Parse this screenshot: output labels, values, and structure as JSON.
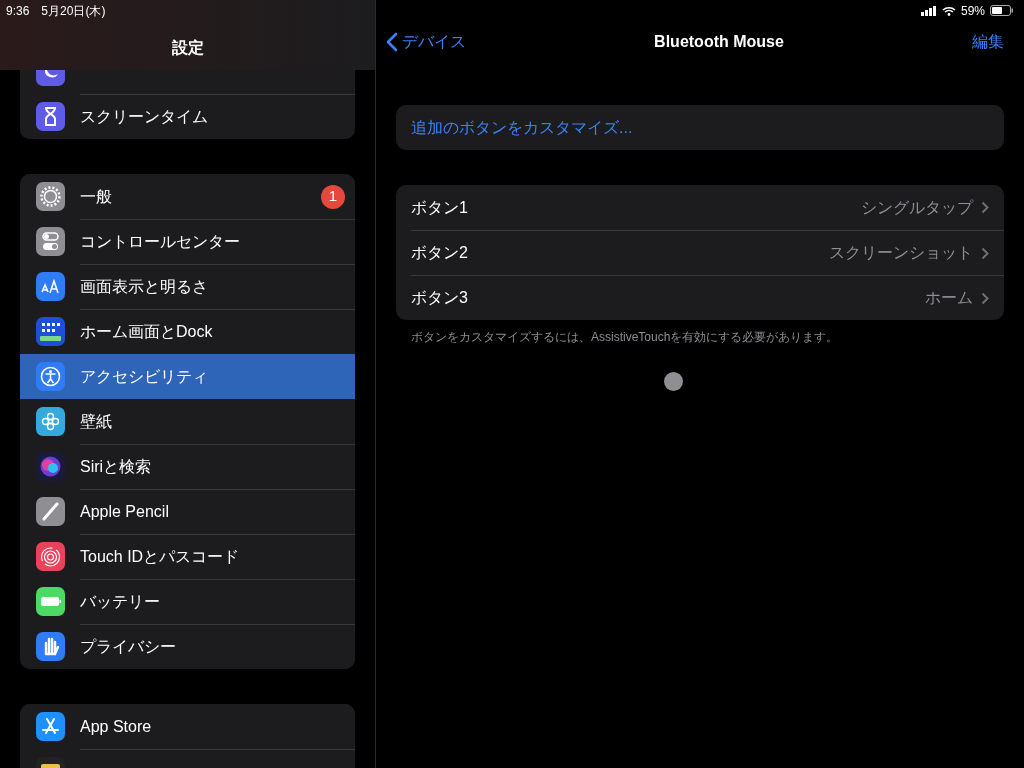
{
  "status_bar": {
    "time": "9:36",
    "date": "5月20日(木)",
    "battery": "59%"
  },
  "sidebar": {
    "title": "設定",
    "groups": [
      {
        "items": [
          {
            "kind": "moon",
            "selected": false
          },
          {
            "label": "スクリーンタイム",
            "kind": "hourglass",
            "selected": false
          }
        ]
      },
      {
        "items": [
          {
            "label": "一般",
            "kind": "gear",
            "selected": false,
            "badge": "1"
          },
          {
            "label": "コントロールセンター",
            "kind": "toggles",
            "selected": false
          },
          {
            "label": "画面表示と明るさ",
            "kind": "text-size",
            "selected": false
          },
          {
            "label": "ホーム画面とDock",
            "kind": "app-grid",
            "selected": false
          },
          {
            "label": "アクセシビリティ",
            "kind": "accessibility",
            "selected": true
          },
          {
            "label": "壁紙",
            "kind": "flower",
            "selected": false
          },
          {
            "label": "Siriと検索",
            "kind": "orb",
            "selected": false
          },
          {
            "label": "Apple Pencil",
            "kind": "pencil",
            "selected": false
          },
          {
            "label": "Touch IDとパスコード",
            "kind": "fingerprint",
            "selected": false
          },
          {
            "label": "バッテリー",
            "kind": "battery",
            "selected": false
          },
          {
            "label": "プライバシー",
            "kind": "hand",
            "selected": false
          }
        ]
      },
      {
        "items": [
          {
            "label": "App Store",
            "kind": "app-store",
            "selected": false
          },
          {
            "kind": "wallet",
            "selected": false
          }
        ]
      }
    ]
  },
  "detail": {
    "back": "デバイス",
    "title": "Bluetooth Mouse",
    "edit": "編集",
    "customize_link": "追加のボタンをカスタマイズ...",
    "buttons": [
      {
        "label": "ボタン1",
        "value": "シングルタップ"
      },
      {
        "label": "ボタン2",
        "value": "スクリーンショット"
      },
      {
        "label": "ボタン3",
        "value": "ホーム"
      }
    ],
    "footnote": "ボタンをカスタマイズするには、AssistiveTouchを有効にする必要があります。"
  }
}
